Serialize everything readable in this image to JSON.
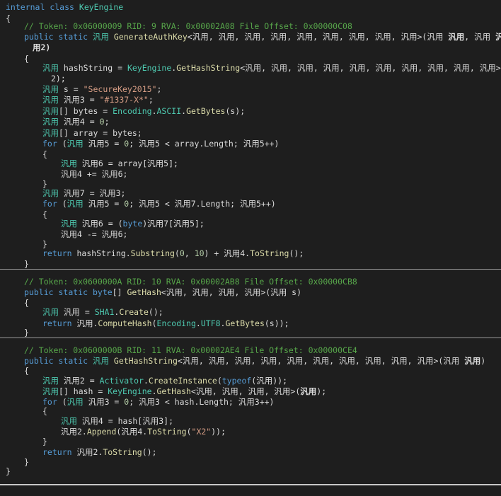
{
  "window": {
    "title": "internal class KeyEngine"
  },
  "code": {
    "class_decl": [
      "internal",
      "class",
      "KeyEngine"
    ],
    "m1": {
      "comment": "// Token: 0x06000009 RID: 9 RVA: 0x00002A08 File Offset: 0x00000C08",
      "sig_public": "public",
      "sig_static": "static",
      "sig_type": "汎用",
      "sig_name": "GenerateAuthKey",
      "sig_generics": "<汎用, 汎用, 汎用, 汎用, 汎用, 汎用, 汎用, 汎用, 汎用>",
      "sig_param_open": "(",
      "sig_p1_type": "汎用",
      "sig_p1_name": "汎用",
      "sig_sep": ", ",
      "sig_p2_type": "汎用",
      "sig_p2_name": "汎",
      "sig_cont": "用2)",
      "l1_type": "汎用",
      "l1_var": " hashString = ",
      "l1_cls": "KeyEngine",
      "l1_dot": ".",
      "l1_meth": "GetHashString",
      "l1_gen": "<汎用, 汎用, 汎用, 汎用, 汎用, 汎用, 汎用, 汎用, 汎用, 汎用>",
      "l1_open": "(",
      "l1_arg": "汎用",
      "l1_cont": "2);",
      "l2_type": "汎用",
      "l2_var": " s = ",
      "l2_str": "\"SecureKey2015\"",
      "l2_end": ";",
      "l3_type": "汎用",
      "l3_var": " 汎用3 = ",
      "l3_str": "\"#1337-X*\"",
      "l3_end": ";",
      "l4_type": "汎用",
      "l4_arr": "[] bytes = ",
      "l4_cls": "Encoding",
      "l4_dot": ".",
      "l4_prop": "ASCII",
      "l4_dot2": ".",
      "l4_meth": "GetBytes",
      "l4_rest": "(s);",
      "l5_type": "汎用",
      "l5_rest": " 汎用4 = ",
      "l5_num": "0",
      "l5_end": ";",
      "l6_type": "汎用",
      "l6_rest": "[] array = bytes;",
      "for1_kw": "for",
      "for1_open": " (",
      "for1_type": "汎用",
      "for1_a": " 汎用5 = ",
      "for1_zero": "0",
      "for1_b": "; 汎用5 < array.",
      "for1_len": "Length",
      "for1_c": "; 汎用5++)",
      "in1_type": "汎用",
      "in1_rest": " 汎用6 = array[汎用5];",
      "in2": "汎用4 += 汎用6;",
      "l7_type": "汎用",
      "l7_rest": " 汎用7 = 汎用3;",
      "for2_kw": "for",
      "for2_open": " (",
      "for2_type": "汎用",
      "for2_a": " 汎用5 = ",
      "for2_zero": "0",
      "for2_b": "; 汎用5 < 汎用7.",
      "for2_len": "Length",
      "for2_c": "; 汎用5++)",
      "in3_type": "汎用",
      "in3_a": " 汎用6 = (",
      "in3_byte": "byte",
      "in3_b": ")汎用7[汎用5];",
      "in4": "汎用4 -= 汎用6;",
      "ret_kw": "return",
      "ret_a": " hashString.",
      "ret_meth": "Substring",
      "ret_b": "(",
      "ret_n1": "0",
      "ret_c": ", ",
      "ret_n2": "10",
      "ret_d": ") + 汎用4.",
      "ret_meth2": "ToString",
      "ret_e": "();"
    },
    "m2": {
      "comment": "// Token: 0x0600000A RID: 10 RVA: 0x00002AB8 File Offset: 0x00000CB8",
      "sig_public": "public",
      "sig_static": "static",
      "sig_byte": "byte",
      "sig_arr": "[] ",
      "sig_name": "GetHash",
      "sig_rest": "<汎用, 汎用, 汎用, 汎用>(汎用 s)",
      "l1_type": "汎用",
      "l1_a": " 汎用 = ",
      "l1_cls": "SHA1",
      "l1_dot": ".",
      "l1_meth": "Create",
      "l1_end": "();",
      "ret_kw": "return",
      "ret_a": " 汎用.",
      "ret_meth": "ComputeHash",
      "ret_b": "(",
      "ret_cls": "Encoding",
      "ret_dot": ".",
      "ret_prop": "UTF8",
      "ret_dot2": ".",
      "ret_meth2": "GetBytes",
      "ret_end": "(s));"
    },
    "m3": {
      "comment": "// Token: 0x0600000B RID: 11 RVA: 0x00002AE4 File Offset: 0x00000CE4",
      "sig_public": "public",
      "sig_static": "static",
      "sig_type": "汎用",
      "sig_name": "GetHashString",
      "sig_rest": "<汎用, 汎用, 汎用, 汎用, 汎用, 汎用, 汎用, 汎用, 汎用, 汎用>(汎用 ",
      "sig_bold": "汎用",
      "sig_end": ")",
      "l1_type": "汎用",
      "l1_a": " 汎用2 = ",
      "l1_cls": "Activator",
      "l1_dot": ".",
      "l1_meth": "CreateInstance",
      "l1_b": "(",
      "l1_kw": "typeof",
      "l1_end": "(汎用));",
      "l2_type": "汎用",
      "l2_a": "[] hash = ",
      "l2_cls": "KeyEngine",
      "l2_dot": ".",
      "l2_meth": "GetHash",
      "l2_gen": "<汎用, 汎用, 汎用, 汎用>(",
      "l2_bold": "汎用",
      "l2_end": ");",
      "for_kw": "for",
      "for_open": " (",
      "for_type": "汎用",
      "for_a": " 汎用3 = ",
      "for_zero": "0",
      "for_b": "; 汎用3 < hash.",
      "for_len": "Length",
      "for_c": "; 汎用3++)",
      "in1_type": "汎用",
      "in1_rest": " 汎用4 = hash[汎用3];",
      "in2_a": "汎用2.",
      "in2_meth": "Append",
      "in2_b": "(汎用4.",
      "in2_meth2": "ToString",
      "in2_c": "(",
      "in2_str": "\"X2\"",
      "in2_end": "));",
      "ret_kw": "return",
      "ret_a": " 汎用2.",
      "ret_meth": "ToString",
      "ret_end": "();"
    },
    "open_brace": "{",
    "close_brace": "}"
  },
  "colors": {
    "background": "#1e1e1e",
    "keyword": "#569cd6",
    "type": "#4ec9b0",
    "method": "#dcdcaa",
    "string": "#d69d85",
    "number": "#b5cea8",
    "comment": "#57a64a",
    "text": "#dcdcdc"
  }
}
